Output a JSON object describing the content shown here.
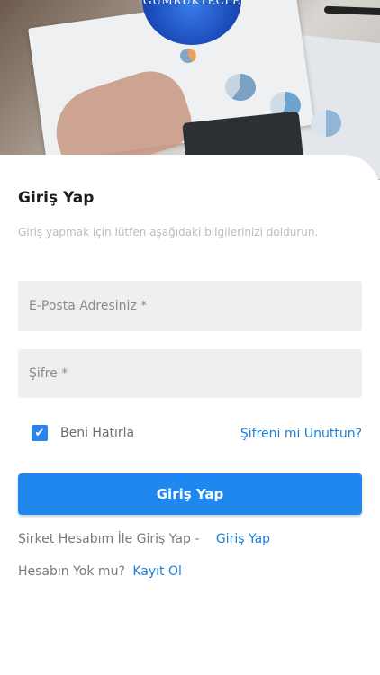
{
  "header": {
    "logo_text": "GUMRUKTECLE"
  },
  "login": {
    "title": "Giriş Yap",
    "subtitle": "Giriş yapmak için lütfen aşağıdaki bilgilerinizi doldurun.",
    "email_placeholder": "E-Posta Adresiniz *",
    "email_value": "",
    "password_placeholder": "Şifre *",
    "password_value": "",
    "remember_label": "Beni Hatırla",
    "remember_checked": true,
    "forgot_link": "Şifreni mi Unuttun?",
    "submit_label": "Giriş Yap",
    "corporate_text": "Şirket Hesabım İle Giriş Yap -",
    "corporate_link": "Giriş Yap",
    "register_text": "Hesabın Yok mu?",
    "register_link": "Kayıt Ol"
  },
  "colors": {
    "accent": "#1e88f0",
    "link": "#1a7fd6",
    "input_bg": "#efefef"
  },
  "icons": {
    "checkbox": "check-icon"
  }
}
